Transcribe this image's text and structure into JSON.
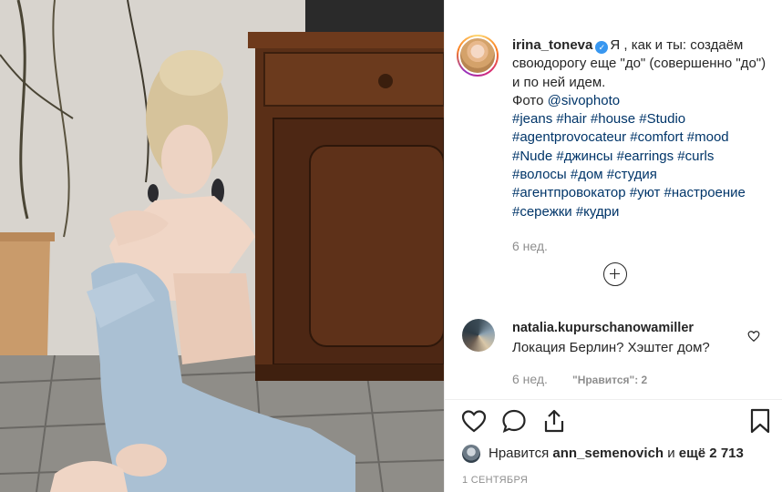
{
  "post": {
    "photo_icon": "photo-woman-jeans",
    "author": {
      "username": "irina_toneva",
      "verified_icon": "verified-badge-icon",
      "avatar_icon": "avatar-irina"
    },
    "caption": {
      "text_line1": "Я , как и ты: создаём своюдорогу еще \"до\" (совершенно \"до\") и по ней идем.",
      "photo_label": "Фото ",
      "photo_link": "@sivophoto",
      "hashtags": "#jeans #hair #house #Studio #agentprovocateur #comfort #mood #Nude #джинсы #earrings #curls #волосы #дом #студия #агентпровокатор #уют #настроение #сережки #кудри"
    },
    "timeago": "6 нед.",
    "more_icon": "plus-circle-icon"
  },
  "comment": {
    "username": "natalia.kupurschanowamiller",
    "text": "Локация Берлин? Хэштег дом?",
    "timeago": "6 нед.",
    "likes": "\"Нравится\": 2"
  },
  "actions": {
    "like_icon": "heart-icon",
    "comment_icon": "comment-icon",
    "share_icon": "share-icon",
    "save_icon": "bookmark-icon"
  },
  "likes": {
    "prefix": "Нравится ",
    "user": "ann_semenovich",
    "middle": " и ",
    "count": "ещё 2 713"
  },
  "date": "1 СЕНТЯБРЯ",
  "colors": {
    "link": "#003569",
    "muted": "#8e8e8e",
    "verified": "#3897f0",
    "text": "#262626"
  }
}
